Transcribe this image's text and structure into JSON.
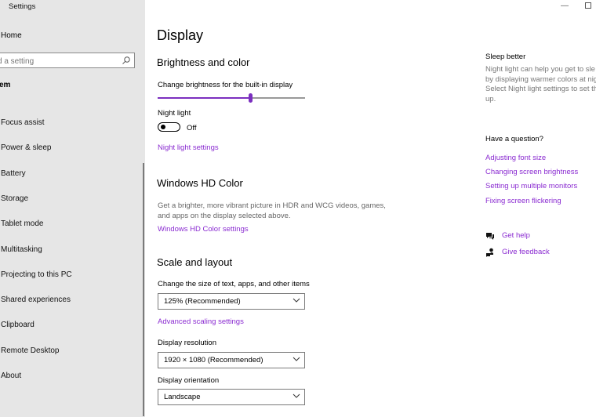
{
  "window": {
    "title": "Settings"
  },
  "sidebar": {
    "home": "Home",
    "search_placeholder": "d a setting",
    "group_label": "em",
    "items": [
      {
        "label": "Focus assist"
      },
      {
        "label": "Power & sleep"
      },
      {
        "label": "Battery"
      },
      {
        "label": "Storage"
      },
      {
        "label": "Tablet mode"
      },
      {
        "label": "Multitasking"
      },
      {
        "label": "Projecting to this PC"
      },
      {
        "label": "Shared experiences"
      },
      {
        "label": "Clipboard"
      },
      {
        "label": "Remote Desktop"
      },
      {
        "label": "About"
      }
    ]
  },
  "main": {
    "title": "Display",
    "brightness": {
      "heading": "Brightness and color",
      "label": "Change brightness for the built-in display",
      "value_fraction": 0.63,
      "night_light_label": "Night light",
      "night_light_state": "Off",
      "night_light_link": "Night light settings"
    },
    "hd": {
      "heading": "Windows HD Color",
      "desc_line1": "Get a brighter, more vibrant picture in HDR and WCG videos, games,",
      "desc_line2": "and apps on the display selected above.",
      "link": "Windows HD Color settings"
    },
    "scale": {
      "heading": "Scale and layout",
      "size_label": "Change the size of text, apps, and other items",
      "size_value": "125% (Recommended)",
      "advanced_link": "Advanced scaling settings",
      "resolution_label": "Display resolution",
      "resolution_value": "1920 × 1080 (Recommended)",
      "orientation_label": "Display orientation",
      "orientation_value": "Landscape"
    }
  },
  "right": {
    "sleep_heading": "Sleep better",
    "sleep_desc": "Night light can help you get to sle\nby displaying warmer colors at nig\nSelect Night light settings to set th\nup.",
    "question_heading": "Have a question?",
    "links": [
      "Adjusting font size",
      "Changing screen brightness",
      "Setting up multiple monitors",
      "Fixing screen flickering"
    ],
    "get_help": "Get help",
    "give_feedback": "Give feedback"
  },
  "colors": {
    "accent": "#8a2bd1",
    "sidebar_bg": "#e6e6e6"
  }
}
